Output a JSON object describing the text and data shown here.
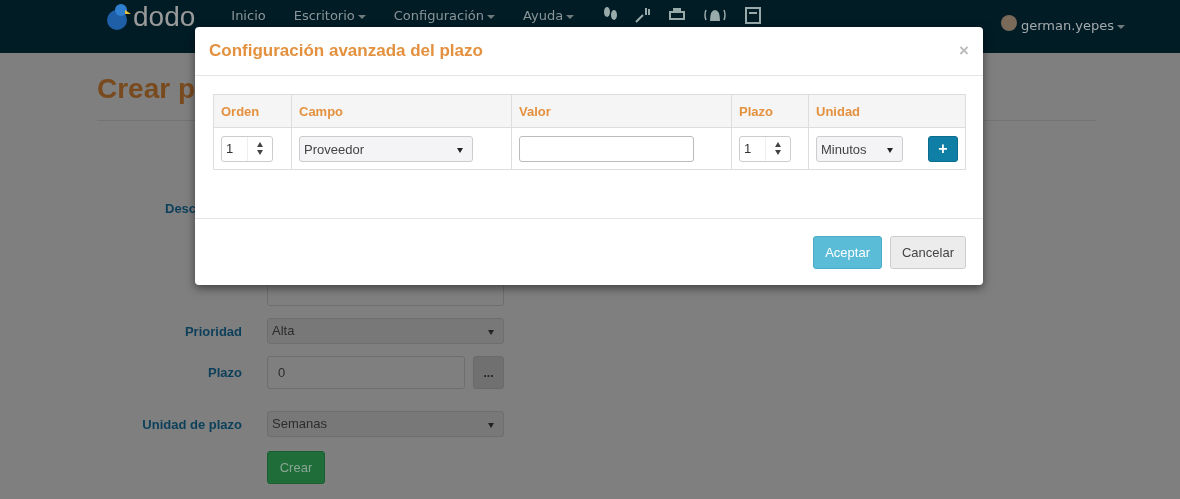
{
  "navbar": {
    "logo": "dodo",
    "menu": [
      {
        "label": "Inicio",
        "dropdown": false
      },
      {
        "label": "Escritorio",
        "dropdown": true
      },
      {
        "label": "Configuración",
        "dropdown": true
      },
      {
        "label": "Ayuda",
        "dropdown": true
      }
    ],
    "user": "german.yepes"
  },
  "page": {
    "title": "Crear p",
    "fields": [
      {
        "label": "Desc",
        "kind": "textarea"
      },
      {
        "label": "Prioridad",
        "kind": "select",
        "value": "Alta"
      },
      {
        "label": "Plazo",
        "kind": "input-button",
        "value": "0",
        "button": "..."
      },
      {
        "label": "Unidad de plazo",
        "kind": "select",
        "value": "Semanas"
      }
    ],
    "submit": "Crear"
  },
  "modal": {
    "title": "Configuración avanzada del plazo",
    "close": "×",
    "columns": [
      "Orden",
      "Campo",
      "Valor",
      "Plazo",
      "Unidad"
    ],
    "rows": [
      {
        "orden": "1",
        "campo": "Proveedor",
        "plazo": "1",
        "unidad": "Minutos",
        "add": "+"
      }
    ],
    "buttons": [
      {
        "label": "Aceptar",
        "kind": "primary"
      },
      {
        "label": "Cancelar",
        "kind": "default"
      }
    ]
  }
}
